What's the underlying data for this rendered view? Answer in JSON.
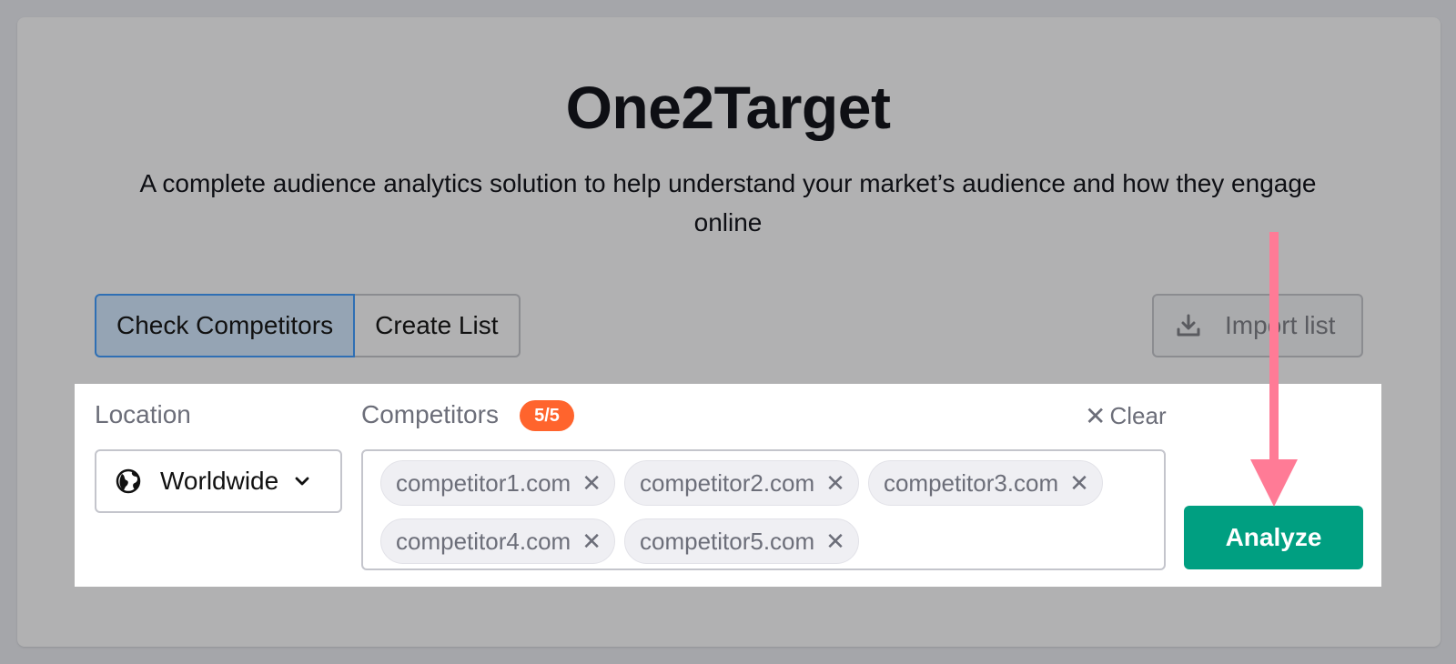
{
  "header": {
    "title": "One2Target",
    "subtitle": "A complete audience analytics solution to help understand your market’s audience and how they engage online"
  },
  "tabs": [
    {
      "label": "Check Competitors",
      "active": true
    },
    {
      "label": "Create List",
      "active": false
    }
  ],
  "import_button": {
    "label": "Import list",
    "icon": "download-icon"
  },
  "location": {
    "label": "Location",
    "value": "Worldwide",
    "icon": "globe-icon"
  },
  "competitors": {
    "label": "Competitors",
    "count_badge": "5/5",
    "clear_label": "Clear",
    "items": [
      {
        "domain": "competitor1.com"
      },
      {
        "domain": "competitor2.com"
      },
      {
        "domain": "competitor3.com"
      },
      {
        "domain": "competitor4.com"
      },
      {
        "domain": "competitor5.com"
      }
    ]
  },
  "analyze_button": {
    "label": "Analyze"
  },
  "colors": {
    "accent_green": "#009f81",
    "badge_orange": "#ff642d",
    "arrow_pink": "#ff7b96",
    "active_tab_border": "#2f6fb4"
  },
  "overlay": {
    "annotation": "arrow-pointing-to-analyze"
  }
}
